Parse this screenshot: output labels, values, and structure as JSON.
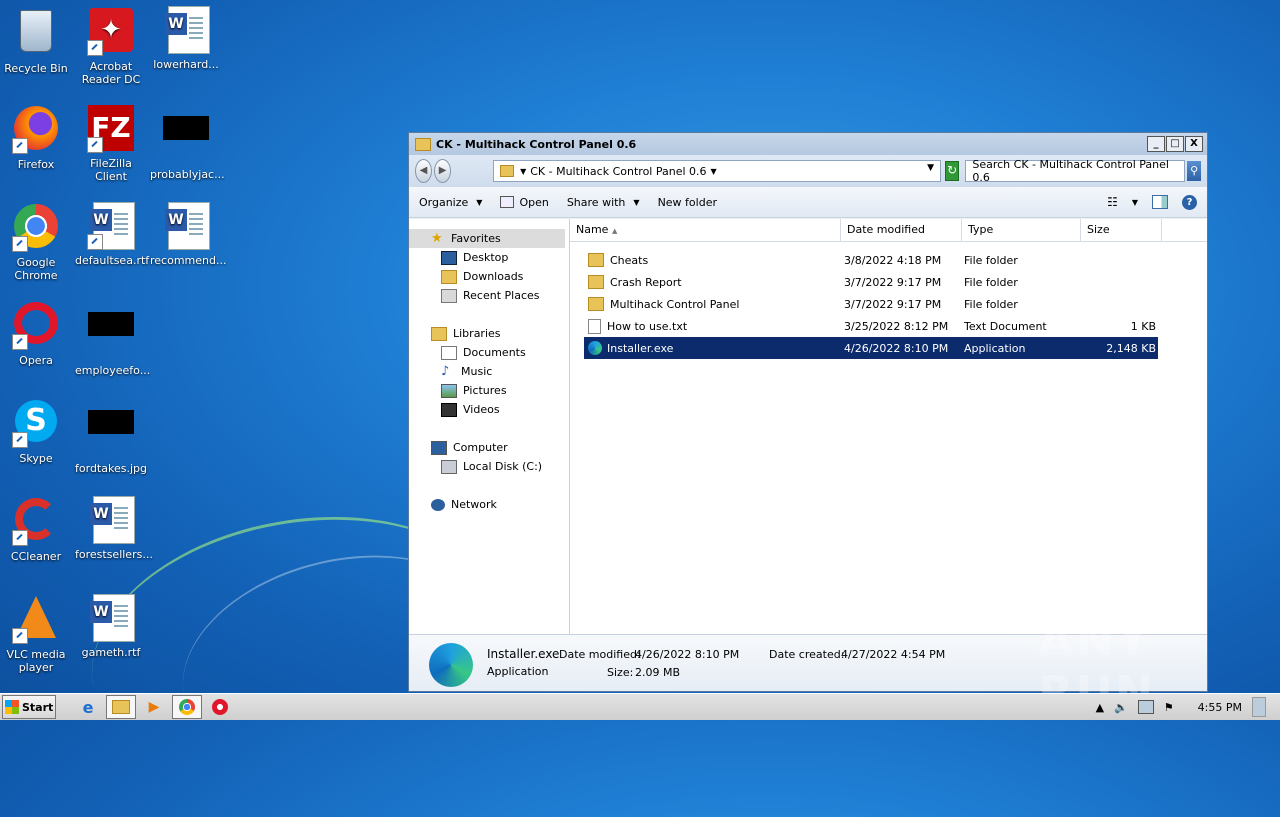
{
  "desktop": {
    "icons": [
      {
        "label": "Recycle Bin"
      },
      {
        "label": "Acrobat Reader DC"
      },
      {
        "label": "lowerhard..."
      },
      {
        "label": "Firefox"
      },
      {
        "label": "FileZilla Client"
      },
      {
        "label": "probablyjac..."
      },
      {
        "label": "Google Chrome"
      },
      {
        "label": "defaultsea.rtf"
      },
      {
        "label": "recommend..."
      },
      {
        "label": "Opera"
      },
      {
        "label": "employeefo..."
      },
      {
        "label": "Skype"
      },
      {
        "label": "fordtakes.jpg"
      },
      {
        "label": "CCleaner"
      },
      {
        "label": "forestsellers..."
      },
      {
        "label": "VLC media player"
      },
      {
        "label": "gameth.rtf"
      }
    ]
  },
  "window": {
    "title": "CK - Multihack Control Panel 0.6",
    "controls": {
      "minimize": "_",
      "maximize": "□",
      "close": "X"
    },
    "address": "CK - Multihack Control Panel 0.6",
    "search_placeholder": "Search CK - Multihack Control Panel 0.6",
    "toolbar": {
      "organize": "Organize",
      "open": "Open",
      "share_with": "Share with",
      "new_folder": "New folder"
    },
    "nav": {
      "favorites": "Favorites",
      "desktop": "Desktop",
      "downloads": "Downloads",
      "recent_places": "Recent Places",
      "libraries": "Libraries",
      "documents": "Documents",
      "music": "Music",
      "pictures": "Pictures",
      "videos": "Videos",
      "computer": "Computer",
      "local_disk": "Local Disk (C:)",
      "network": "Network"
    },
    "columns": {
      "name": "Name",
      "date_modified": "Date modified",
      "type": "Type",
      "size": "Size"
    },
    "files": [
      {
        "name": "Cheats",
        "date": "3/8/2022 4:18 PM",
        "type": "File folder",
        "size": "",
        "kind": "folder"
      },
      {
        "name": "Crash Report",
        "date": "3/7/2022 9:17 PM",
        "type": "File folder",
        "size": "",
        "kind": "folder"
      },
      {
        "name": "Multihack Control Panel",
        "date": "3/7/2022 9:17 PM",
        "type": "File folder",
        "size": "",
        "kind": "folder"
      },
      {
        "name": "How to use.txt",
        "date": "3/25/2022 8:12 PM",
        "type": "Text Document",
        "size": "1 KB",
        "kind": "txt"
      },
      {
        "name": "Installer.exe",
        "date": "4/26/2022 8:10 PM",
        "type": "Application",
        "size": "2,148 KB",
        "kind": "exe",
        "selected": true
      }
    ],
    "details": {
      "filename": "Installer.exe",
      "filetype": "Application",
      "date_modified_label": "Date modified:",
      "date_modified": "4/26/2022 8:10 PM",
      "size_label": "Size:",
      "size": "2.09 MB",
      "date_created_label": "Date created:",
      "date_created": "4/27/2022 4:54 PM"
    }
  },
  "taskbar": {
    "start": "Start",
    "clock": "4:55 PM"
  },
  "watermark": "ANY RUN"
}
